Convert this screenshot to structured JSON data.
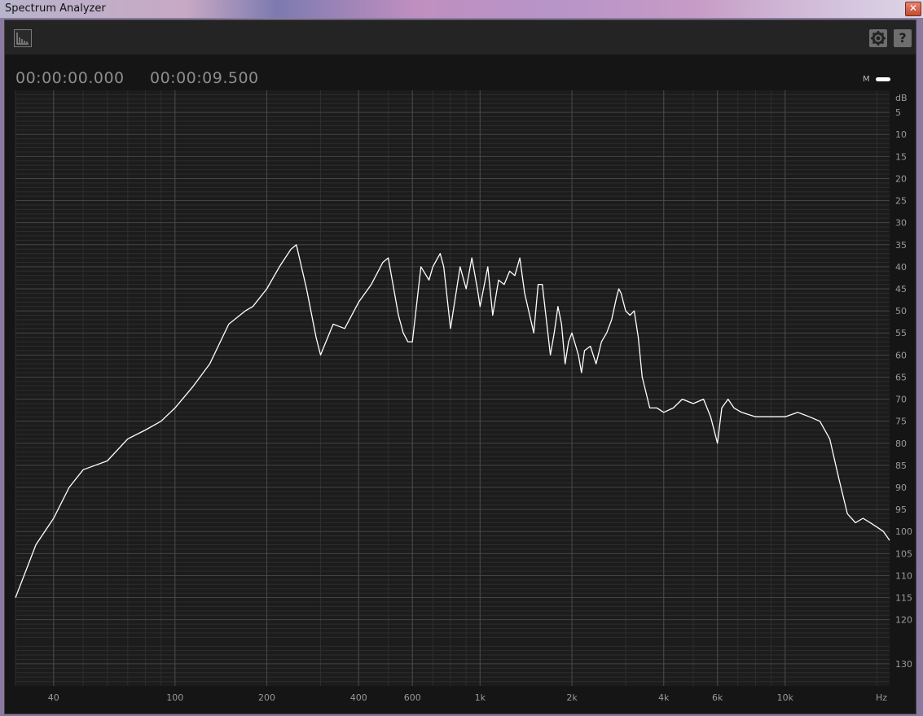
{
  "window": {
    "title": "Spectrum Analyzer"
  },
  "toolbar": {
    "view_icon": "spectrum-view-icon",
    "settings_icon": "gear-icon",
    "help_label": "?"
  },
  "time": {
    "start": "00:00:00.000",
    "end": "00:00:09.500"
  },
  "legend": {
    "channel": "M",
    "color": "#ffffff"
  },
  "colors": {
    "background": "#151515",
    "plot_bg": "#1c1c1c",
    "grid": "#3a3a3a",
    "trace": "#ffffff",
    "tick_text": "#9a9a9a"
  },
  "chart_data": {
    "type": "line",
    "x_scale": "log",
    "xlim": [
      30,
      22000
    ],
    "ylim": [
      0,
      -135
    ],
    "xlabel": "Hz",
    "ylabel": "dB",
    "x_ticks": [
      {
        "v": 40,
        "label": "40"
      },
      {
        "v": 100,
        "label": "100"
      },
      {
        "v": 200,
        "label": "200"
      },
      {
        "v": 400,
        "label": "400"
      },
      {
        "v": 600,
        "label": "600"
      },
      {
        "v": 1000,
        "label": "1k"
      },
      {
        "v": 2000,
        "label": "2k"
      },
      {
        "v": 4000,
        "label": "4k"
      },
      {
        "v": 6000,
        "label": "6k"
      },
      {
        "v": 10000,
        "label": "10k"
      }
    ],
    "y_ticks": [
      {
        "v": -5,
        "label": "5"
      },
      {
        "v": -10,
        "label": "10"
      },
      {
        "v": -15,
        "label": "15"
      },
      {
        "v": -20,
        "label": "20"
      },
      {
        "v": -25,
        "label": "25"
      },
      {
        "v": -30,
        "label": "30"
      },
      {
        "v": -35,
        "label": "35"
      },
      {
        "v": -40,
        "label": "40"
      },
      {
        "v": -45,
        "label": "45"
      },
      {
        "v": -50,
        "label": "50"
      },
      {
        "v": -55,
        "label": "55"
      },
      {
        "v": -60,
        "label": "60"
      },
      {
        "v": -65,
        "label": "65"
      },
      {
        "v": -70,
        "label": "70"
      },
      {
        "v": -75,
        "label": "75"
      },
      {
        "v": -80,
        "label": "80"
      },
      {
        "v": -85,
        "label": "85"
      },
      {
        "v": -90,
        "label": "90"
      },
      {
        "v": -95,
        "label": "95"
      },
      {
        "v": -100,
        "label": "100"
      },
      {
        "v": -105,
        "label": "105"
      },
      {
        "v": -110,
        "label": "110"
      },
      {
        "v": -115,
        "label": "115"
      },
      {
        "v": -120,
        "label": "120"
      },
      {
        "v": -130,
        "label": "130"
      }
    ],
    "series": [
      {
        "color": "#ffffff",
        "x": [
          30,
          35,
          40,
          45,
          50,
          60,
          70,
          80,
          90,
          100,
          115,
          130,
          150,
          170,
          180,
          200,
          220,
          240,
          250,
          270,
          290,
          300,
          330,
          360,
          400,
          440,
          480,
          500,
          540,
          560,
          580,
          600,
          640,
          680,
          700,
          740,
          760,
          800,
          860,
          900,
          940,
          980,
          1000,
          1060,
          1100,
          1150,
          1200,
          1250,
          1300,
          1350,
          1400,
          1500,
          1550,
          1600,
          1700,
          1750,
          1800,
          1850,
          1900,
          1950,
          2000,
          2100,
          2150,
          2200,
          2300,
          2400,
          2500,
          2600,
          2700,
          2800,
          2850,
          2900,
          3000,
          3100,
          3200,
          3300,
          3400,
          3600,
          3800,
          4000,
          4300,
          4600,
          5000,
          5400,
          5700,
          6000,
          6200,
          6500,
          6800,
          7200,
          8000,
          9000,
          10000,
          11000,
          12000,
          13000,
          14000,
          15000,
          16000,
          17000,
          18000,
          19000,
          20000,
          21000,
          22000
        ],
        "y": [
          -115,
          -103,
          -97,
          -90,
          -86,
          -84,
          -79,
          -77,
          -75,
          -72,
          -67,
          -62,
          -53,
          -50,
          -49,
          -45,
          -40,
          -36,
          -35,
          -45,
          -56,
          -60,
          -53,
          -54,
          -48,
          -44,
          -39,
          -38,
          -51,
          -55,
          -57,
          -57,
          -40,
          -43,
          -40,
          -37,
          -40,
          -54,
          -40,
          -45,
          -38,
          -45,
          -49,
          -40,
          -51,
          -43,
          -44,
          -41,
          -42,
          -38,
          -46,
          -55,
          -44,
          -44,
          -60,
          -55,
          -49,
          -53,
          -62,
          -57,
          -55,
          -60,
          -64,
          -59,
          -58,
          -62,
          -57,
          -55,
          -52,
          -47,
          -45,
          -46,
          -50,
          -51,
          -50,
          -56,
          -65,
          -72,
          -72,
          -73,
          -72,
          -70,
          -71,
          -70,
          -74,
          -80,
          -72,
          -70,
          -72,
          -73,
          -74,
          -74,
          -74,
          -73,
          -74,
          -75,
          -79,
          -88,
          -96,
          -98,
          -97,
          -98,
          -99,
          -100,
          -102
        ]
      }
    ]
  }
}
